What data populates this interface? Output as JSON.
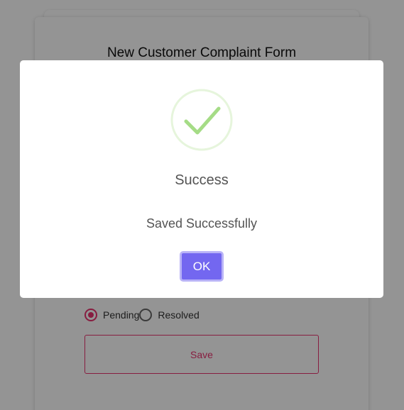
{
  "form": {
    "title": "New Customer Complaint Form",
    "status_options": [
      {
        "label": "Pending",
        "selected": true
      },
      {
        "label": "Resolved",
        "selected": false
      }
    ],
    "save_label": "Save",
    "accent_color": "#e8336e"
  },
  "dialog": {
    "icon": "success-check-icon",
    "title": "Success",
    "message": "Saved Successfully",
    "ok_label": "OK",
    "ok_color": "#7367f0",
    "check_color": "#a5dc86"
  }
}
